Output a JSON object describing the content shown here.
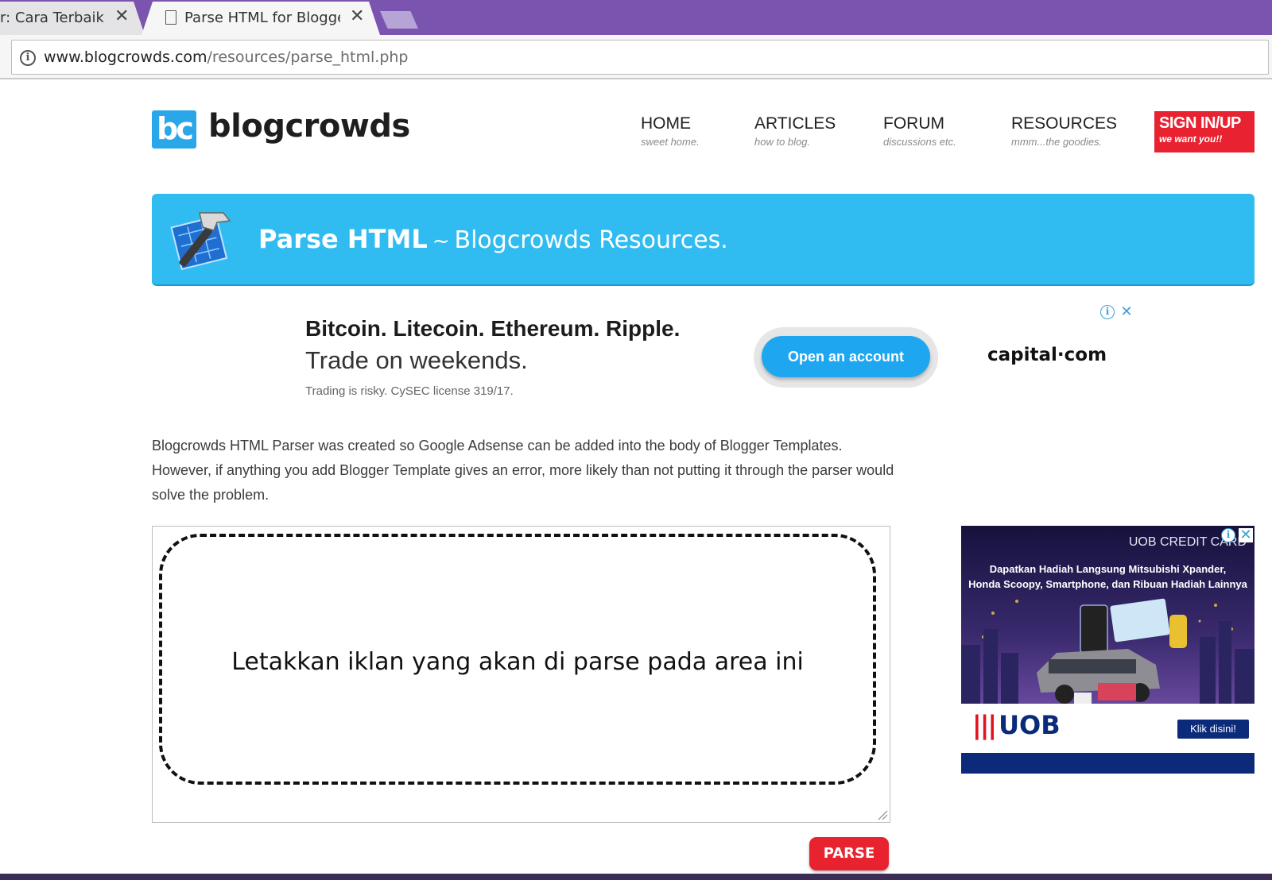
{
  "browser": {
    "tabs": [
      {
        "title": "r: Cara Terbaik dan",
        "active": false
      },
      {
        "title": "Parse HTML for Blogger",
        "active": true
      }
    ],
    "close_glyph": "✕",
    "url_host": "www.blogcrowds.com",
    "url_path": "/resources/parse_html.php",
    "colors": {
      "tabbar": "#7b54b0"
    }
  },
  "site": {
    "logo_mark": "bc",
    "logo_text": "blogcrowds",
    "nav": [
      {
        "label": "HOME",
        "sub": "sweet home."
      },
      {
        "label": "ARTICLES",
        "sub": "how to blog."
      },
      {
        "label": "FORUM",
        "sub": "discussions etc."
      },
      {
        "label": "RESOURCES",
        "sub": "mmm...the goodies."
      }
    ],
    "signin": {
      "label": "SIGN IN/UP",
      "sub": "we want you!!"
    },
    "colors": {
      "banner": "#30bcf1",
      "signin": "#e82230",
      "parse_button": "#e8232f"
    }
  },
  "banner": {
    "icon": "hammer-blueprint-icon",
    "title_strong": "Parse HTML",
    "tilde": "~",
    "title_light": "Blogcrowds Resources."
  },
  "ad_top": {
    "headline": "Bitcoin. Litecoin. Ethereum. Ripple.",
    "subline": "Trade on weekends.",
    "disclaimer": "Trading is risky. CySEC license 319/17.",
    "button": "Open an account",
    "brand": "capital·com",
    "adchoices_glyph": "i",
    "close_glyph": "✕"
  },
  "description": "Blogcrowds HTML Parser was created so Google Adsense can be added into the body of Blogger Templates. However, if anything you add Blogger Template gives an error, more likely than not putting it through the parser would solve the problem.",
  "parser": {
    "overlay_text": "Letakkan iklan yang akan di parse pada area ini",
    "button": "PARSE"
  },
  "ad_side": {
    "top_label": "UOB CREDIT CARD",
    "headline_1": "Dapatkan Hadiah Langsung Mitsubishi Xpander,",
    "headline_2": "Honda Scoopy, Smartphone, dan Ribuan Hadiah Lainnya",
    "brand": "UOB",
    "brand_bars": "|||",
    "cta": "Klik disini!",
    "adchoices_glyph": "i",
    "close_glyph": "✕"
  }
}
